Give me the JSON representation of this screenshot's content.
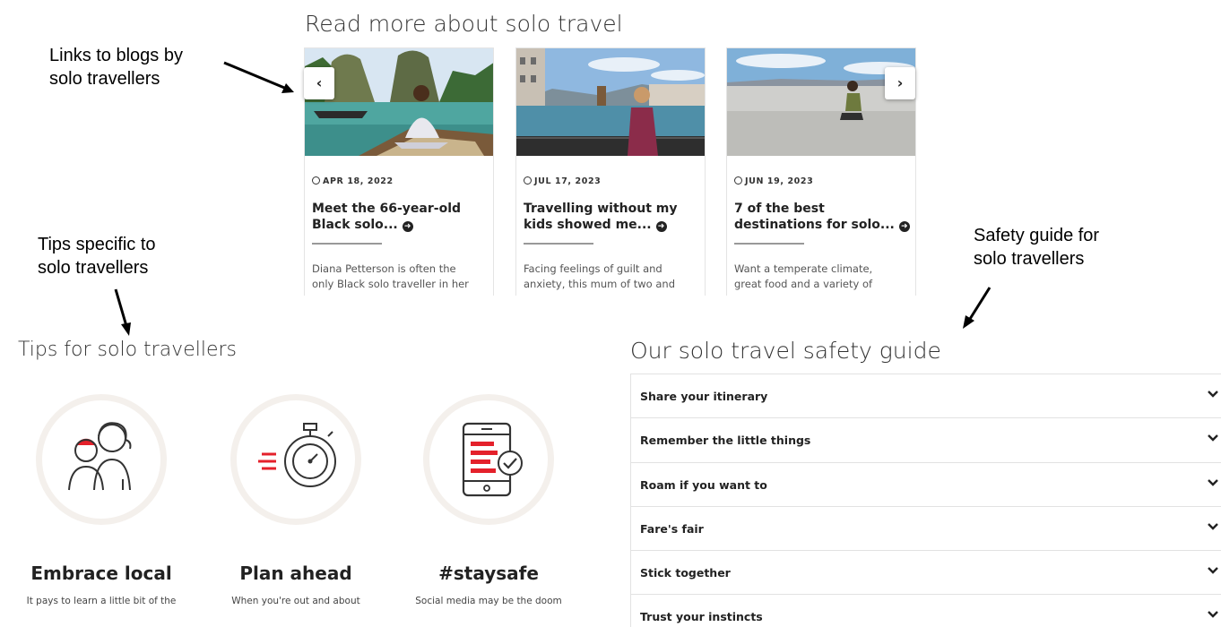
{
  "annotations": {
    "blogs": [
      "Links to blogs by",
      "solo travellers"
    ],
    "tips": [
      "Tips specific to",
      "solo travellers"
    ],
    "safety": [
      "Safety guide for",
      "solo travellers"
    ]
  },
  "blog_section": {
    "title": "Read more about solo travel",
    "prev_label": "‹",
    "next_label": "›",
    "cards": [
      {
        "date": "APR 18, 2022",
        "title_line1": "Meet the 66-year-old",
        "title_line2": "Black solo...",
        "excerpt_line1": "Diana Petterson is often the",
        "excerpt_line2": "only Black solo traveller in her"
      },
      {
        "date": "JUL 17, 2023",
        "title_line1": "Travelling without my",
        "title_line2": "kids showed me...",
        "excerpt_line1": "Facing feelings of guilt and",
        "excerpt_line2": "anxiety, this mum of two and"
      },
      {
        "date": "JUN 19, 2023",
        "title_line1": "7 of the best",
        "title_line2": "destinations for solo...",
        "excerpt_line1": "Want a temperate climate,",
        "excerpt_line2": "great food and a variety of"
      }
    ]
  },
  "tips_section": {
    "title": "Tips for solo travellers",
    "tips": [
      {
        "icon": "people-icon",
        "title": "Embrace local",
        "text": "It pays to learn a little bit of the"
      },
      {
        "icon": "stopwatch-icon",
        "title": "Plan ahead",
        "text": "When you're out and about"
      },
      {
        "icon": "phone-check-icon",
        "title": "#staysafe",
        "text": "Social media may be the doom"
      }
    ]
  },
  "safety_section": {
    "title": "Our solo travel safety guide",
    "items": [
      "Share your itinerary",
      "Remember the little things",
      "Roam if you want to",
      "Fare's fair",
      "Stick together",
      "Trust your instincts"
    ]
  },
  "colors": {
    "accent_red": "#e4212b",
    "icon_dark": "#333333",
    "circle_ring": "#f4f0ec"
  }
}
